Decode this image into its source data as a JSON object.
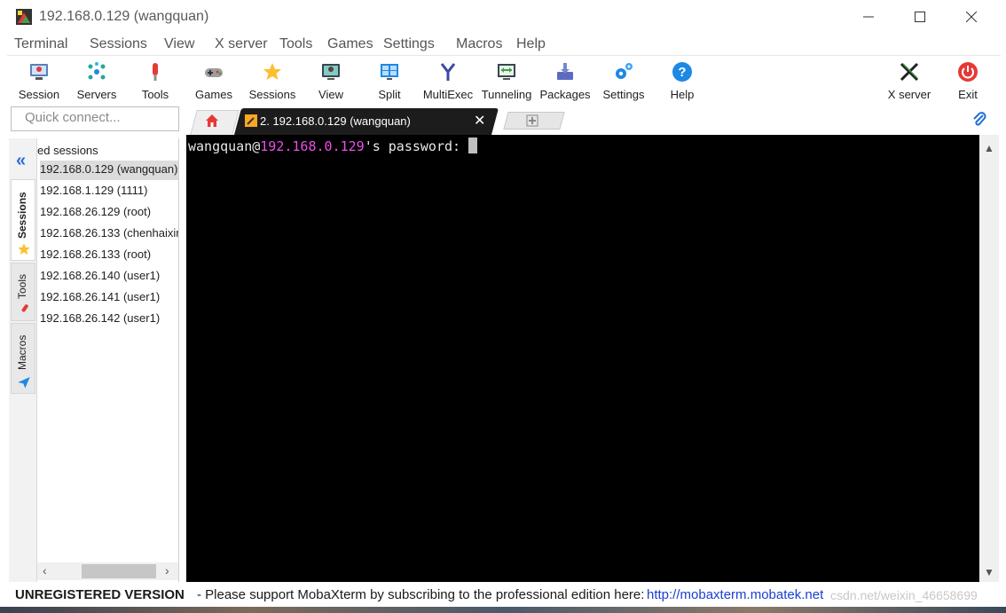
{
  "window": {
    "title": "192.168.0.129 (wangquan)"
  },
  "menu": [
    "Terminal",
    "Sessions",
    "View",
    "X server",
    "Tools",
    "Games",
    "Settings",
    "Macros",
    "Help"
  ],
  "toolbar": {
    "session": "Session",
    "servers": "Servers",
    "tools": "Tools",
    "games": "Games",
    "sessions": "Sessions",
    "view": "View",
    "split": "Split",
    "multiexec": "MultiExec",
    "tunneling": "Tunneling",
    "packages": "Packages",
    "settings": "Settings",
    "help": "Help",
    "xserver": "X server",
    "exit": "Exit"
  },
  "quick_connect": {
    "placeholder": "Quick connect..."
  },
  "tabs": {
    "active_label": "2. 192.168.0.129 (wangquan)",
    "close_glyph": "✕"
  },
  "side_tabs": {
    "sessions": "Sessions",
    "tools": "Tools",
    "macros": "Macros"
  },
  "sessions_panel": {
    "header": "ed sessions",
    "items": [
      "192.168.0.129 (wangquan)",
      "192.168.1.129 (1111)",
      "192.168.26.129 (root)",
      "192.168.26.133 (chenhaixir",
      "192.168.26.133 (root)",
      "192.168.26.140 (user1)",
      "192.168.26.141 (user1)",
      "192.168.26.142 (user1)"
    ]
  },
  "terminal": {
    "user": "wangquan@",
    "host": "192.168.0.129",
    "rest": "'s password: "
  },
  "status": {
    "unregistered": "UNREGISTERED VERSION",
    "message": "-  Please support MobaXterm by subscribing to the professional edition here:",
    "link": "http://mobaxterm.mobatek.net",
    "watermark": "csdn.net/weixin_46658699"
  },
  "colors": {
    "terminal_bg": "#000000",
    "terminal_host": "#e94fe8",
    "link": "#1a3fd0",
    "accent_blue": "#2a6fd6"
  }
}
